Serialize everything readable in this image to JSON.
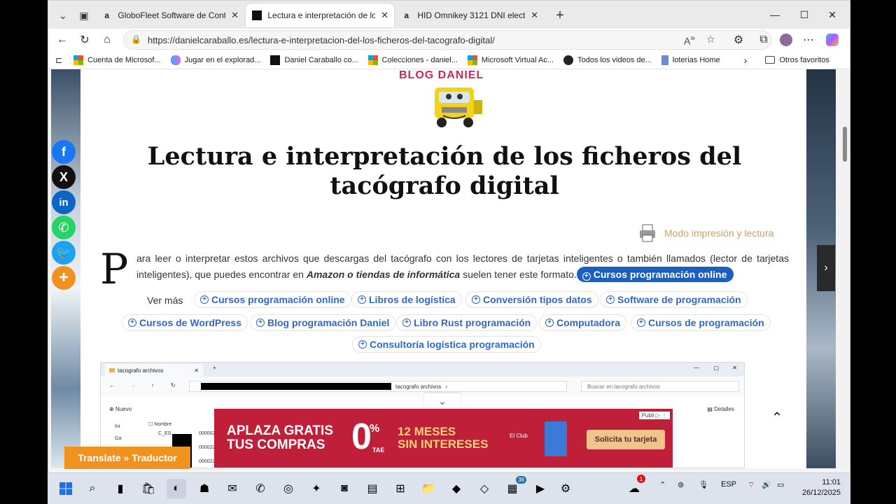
{
  "tabs": [
    {
      "title": "GloboFleet Software de Control d",
      "favicon": "a",
      "active": false
    },
    {
      "title": "Lectura e interpretación de los fic",
      "favicon": "black-square",
      "active": true
    },
    {
      "title": "HID Omnikey 3121 DNI electrónic",
      "favicon": "a",
      "active": false
    }
  ],
  "toolbar": {
    "url": "https://danielcaraballo.es/lectura-e-interpretacion-del-los-ficheros-del-tacografo-digital/"
  },
  "favorites": [
    {
      "label": "Cuenta de Microsof...",
      "icon": "microsoft-icon"
    },
    {
      "label": "Jugar en el explorad...",
      "icon": "butterfly-icon"
    },
    {
      "label": "Daniel Caraballo co...",
      "icon": "black-square-icon"
    },
    {
      "label": "Colecciones - daniel...",
      "icon": "microsoft-icon"
    },
    {
      "label": "Microsoft Virtual Ac...",
      "icon": "microsoft-icon"
    },
    {
      "label": "Todos los videos de...",
      "icon": "circle-icon"
    },
    {
      "label": "loterias  Home",
      "icon": "page-icon"
    }
  ],
  "other_favorites": "Otros favoritos",
  "page": {
    "blog_logo": "BLOG  DANIEL",
    "title": "Lectura e interpretación de los ficheros del tacógrafo digital",
    "print_link": "Modo impresión y lectura",
    "drop_cap": "P",
    "para_1": "ara leer o interpretar estos archivos que descargas del tacógrafo con los lectores de tarjetas inteligentes o también llamados (lector de tarjetas inteligentes), que puedes encontrar en ",
    "para_bold": "Amazon o tiendas de informática",
    "para_2": " suelen tener este formato.",
    "para_pill": "Cursos programación online",
    "ver_mas": "Ver más",
    "chips": [
      "Cursos programación online",
      "Libros de logística",
      "Conversión tipos datos",
      "Software de programación",
      "Cursos de WordPress",
      "Blog programación Daniel",
      "Libro Rust programación",
      "Computadora",
      "Cursos de programación",
      "Consultoría logística programación"
    ]
  },
  "shot": {
    "tab": "tacografo archivos",
    "path": "tacografo archivos",
    "search": "Buscar en tacografo archivos",
    "new": "Nuevo",
    "details": "Detalles",
    "name_col": "Nombre",
    "side": [
      "Ini",
      "Ga"
    ],
    "files": [
      "C_ES",
      "000002_",
      "000022_",
      "000022_"
    ]
  },
  "ad": {
    "line1": "APLAZA GRATIS",
    "line2": "TUS COMPRAS",
    "zero": "0",
    "pct": "%",
    "tae": "TAE",
    "months1": "12 MESES",
    "months2": "SIN INTERESES",
    "club": "El Club",
    "cta": "Solicita tu tarjeta",
    "publi": "Publi"
  },
  "translate": "Translate » Traductor",
  "taskbar": {
    "lang": "ESP",
    "time": "11:01",
    "date": "26/12/2025",
    "badge_notif": "1",
    "badge_app": "36"
  },
  "colors": {
    "accent": "#1b5fbf",
    "chip_text": "#2f69c2",
    "print_link": "#c9a15e",
    "translate": "#f1911e",
    "ad_bg": "#c01f3a"
  }
}
